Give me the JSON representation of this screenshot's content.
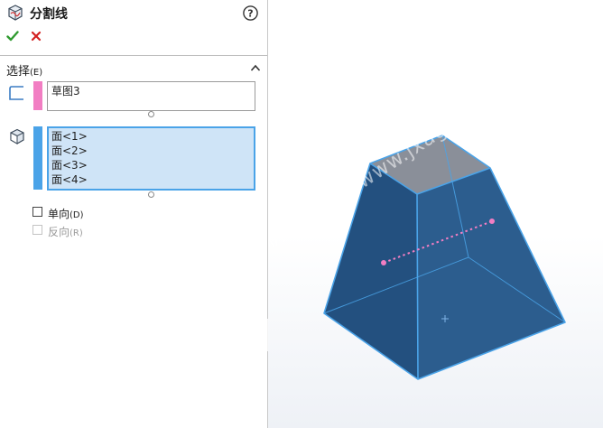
{
  "property_manager": {
    "title": "分割线",
    "title_icon": "split-line-icon",
    "help_icon": "help-icon",
    "ok_icon": "check-icon",
    "cancel_icon": "close-icon",
    "section": {
      "title": "选择",
      "accelerator": "(E)",
      "collapse_icon": "chevron-up-icon"
    },
    "sketch_field": {
      "icon": "sketch-icon",
      "color": "#f27ec3",
      "items": [
        "草图3"
      ]
    },
    "faces_field": {
      "icon": "face-cube-icon",
      "color": "#4aa3e8",
      "items": [
        "面<1>",
        "面<2>",
        "面<3>",
        "面<4>"
      ]
    },
    "options": [
      {
        "label": "单向",
        "accelerator": "(D)",
        "checked": false,
        "enabled": true
      },
      {
        "label": "反向",
        "accelerator": "(R)",
        "checked": false,
        "enabled": false
      }
    ]
  },
  "viewport": {
    "watermark": "机械制图网 www.jxage.com",
    "model_colors": {
      "face": "#2c5d8e",
      "face_dark": "#234d78",
      "top_face": "#8a8f99",
      "edge_highlight": "#4aa3e8",
      "split_line": "#f27ec3"
    }
  }
}
